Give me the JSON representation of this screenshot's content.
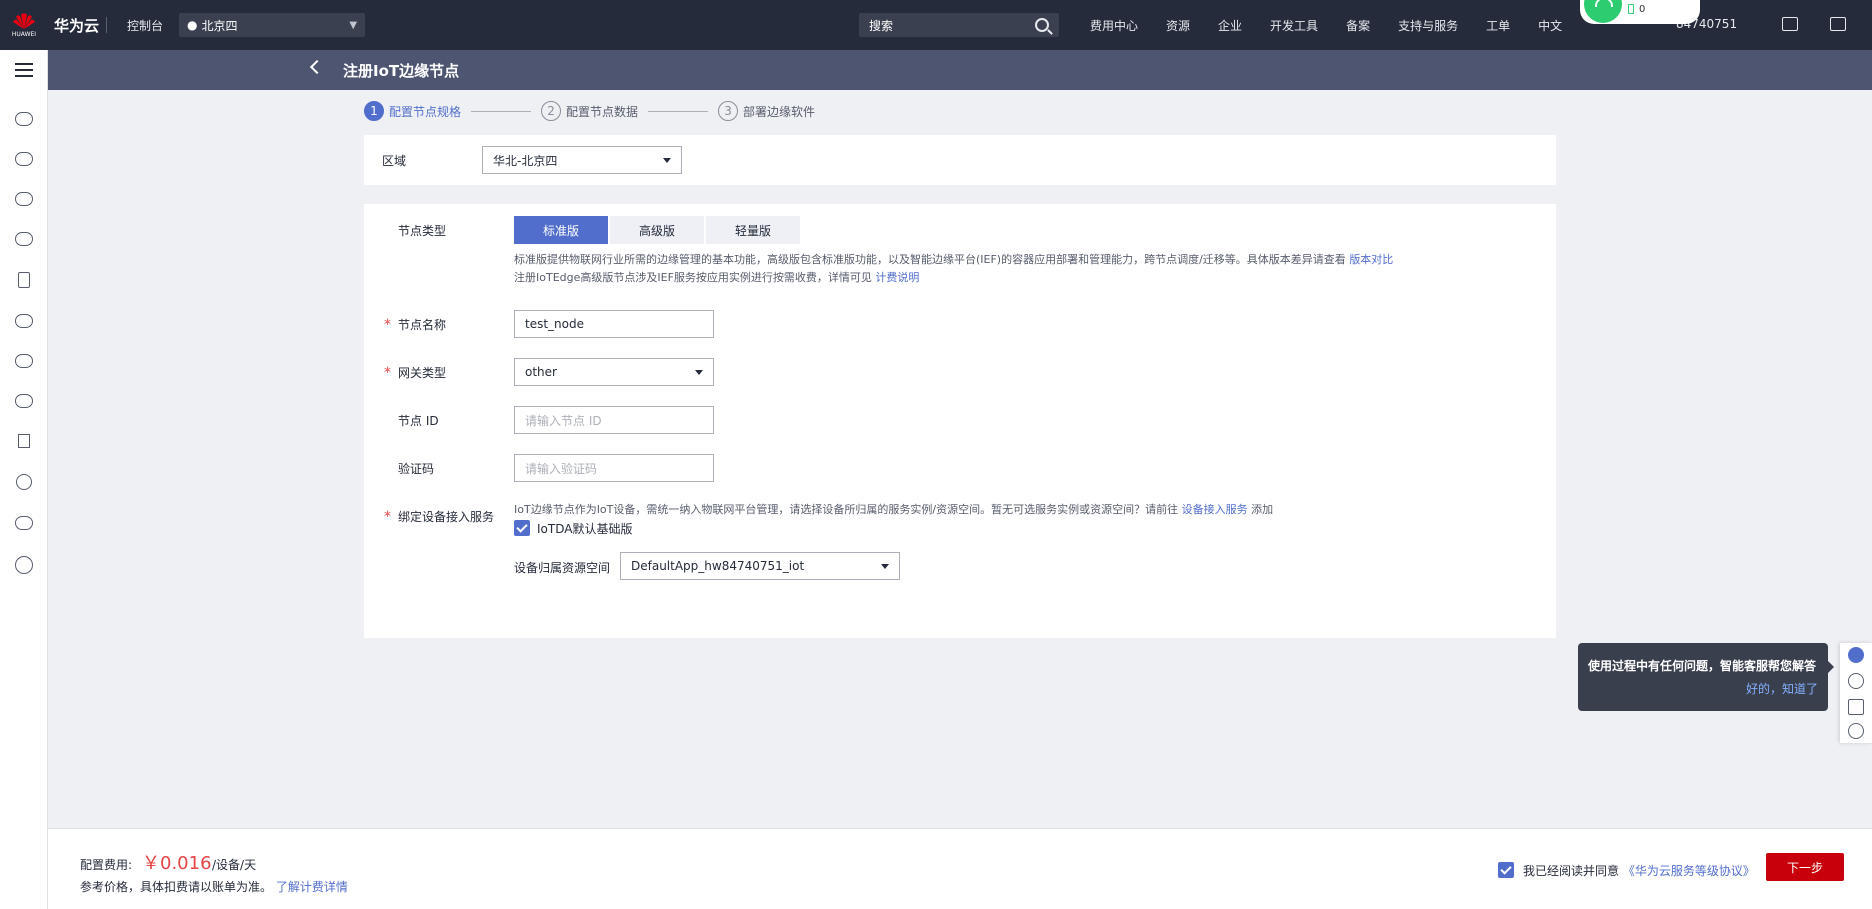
{
  "topnav": {
    "brand": "华为云",
    "console": "控制台",
    "region": "北京四",
    "search_placeholder": "搜索",
    "menu": [
      "费用中心",
      "资源",
      "企业",
      "开发工具",
      "备案",
      "支持与服务",
      "工单"
    ],
    "lang": "中文",
    "user": "84740751",
    "wifi_count": "0"
  },
  "page": {
    "title": "注册IoT边缘节点"
  },
  "steps": [
    {
      "num": "1",
      "label": "配置节点规格"
    },
    {
      "num": "2",
      "label": "配置节点数据"
    },
    {
      "num": "3",
      "label": "部署边缘软件"
    }
  ],
  "region_card": {
    "label": "区域",
    "value": "华北-北京四"
  },
  "form": {
    "node_type_label": "节点类型",
    "tabs": [
      "标准版",
      "高级版",
      "轻量版"
    ],
    "desc_line1": "标准版提供物联网行业所需的边缘管理的基本功能，高级版包含标准版功能，以及智能边缘平台(IEF)的容器应用部署和管理能力，跨节点调度/迁移等。具体版本差异请查看",
    "desc_link1": "版本对比",
    "desc_line2": "注册IoTEdge高级版节点涉及IEF服务按应用实例进行按需收费，详情可见",
    "desc_link2": "计费说明",
    "node_name_label": "节点名称",
    "node_name_value": "test_node",
    "gateway_label": "网关类型",
    "gateway_value": "other",
    "node_id_label": "节点 ID",
    "node_id_placeholder": "请输入节点 ID",
    "verify_label": "验证码",
    "verify_placeholder": "请输入验证码",
    "bind_label": "绑定设备接入服务",
    "bind_desc": "IoT边缘节点作为IoT设备，需统一纳入物联网平台管理，请选择设备所归属的服务实例/资源空间。暂无可选服务实例或资源空间？请前往",
    "bind_link": "设备接入服务",
    "bind_tail": "添加",
    "iotda_check": "IoTDA默认基础版",
    "space_label": "设备归属资源空间",
    "space_value": "DefaultApp_hw84740751_iot"
  },
  "bottom": {
    "fee_label": "配置费用:",
    "fee_price": "￥0.016",
    "fee_unit": "/设备/天",
    "fee_note": "参考价格，具体扣费请以账单为准。",
    "fee_link": "了解计费详情",
    "agree_text": "我已经阅读并同意",
    "agree_link": "《华为云服务等级协议》",
    "next": "下一步"
  },
  "tooltip": {
    "text": "使用过程中有任何问题，智能客服帮您解答",
    "ok": "好的，知道了"
  }
}
